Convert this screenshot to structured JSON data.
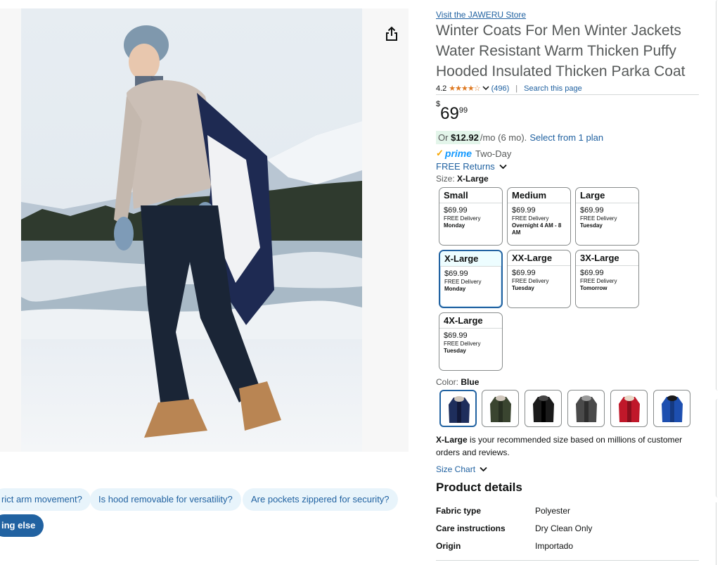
{
  "store_link": "Visit the JAWERU Store",
  "title": "Winter Coats For Men Winter Jackets Water Resistant Warm Thicken Puffy Hooded Insulated Thicken Parka Coat",
  "rating": {
    "value": "4.2",
    "stars": "★★★★☆",
    "count": "(496)",
    "search_link": "Search this page"
  },
  "price": {
    "currency": "$",
    "whole": "69",
    "cents": "99"
  },
  "installment": {
    "or": "Or",
    "amount": "$12.92",
    "period": "/mo (6 mo).",
    "plan_link": "Select from 1 plan"
  },
  "prime": {
    "check": "✓",
    "word": "prime",
    "speed": "Two-Day"
  },
  "free_returns": "FREE Returns",
  "size": {
    "label": "Size:",
    "selected": "X-Large"
  },
  "sizes": [
    {
      "name": "Small",
      "price": "$69.99",
      "delivery": "FREE Delivery",
      "day": "Monday"
    },
    {
      "name": "Medium",
      "price": "$69.99",
      "delivery": "FREE Delivery",
      "day": "Overnight 4 AM - 8 AM"
    },
    {
      "name": "Large",
      "price": "$69.99",
      "delivery": "FREE Delivery",
      "day": "Tuesday"
    },
    {
      "name": "X-Large",
      "price": "$69.99",
      "delivery": "FREE Delivery",
      "day": "Monday"
    },
    {
      "name": "XX-Large",
      "price": "$69.99",
      "delivery": "FREE Delivery",
      "day": "Tuesday"
    },
    {
      "name": "3X-Large",
      "price": "$69.99",
      "delivery": "FREE Delivery",
      "day": "Tomorrow"
    },
    {
      "name": "4X-Large",
      "price": "$69.99",
      "delivery": "FREE Delivery",
      "day": "Tuesday"
    }
  ],
  "color": {
    "label": "Color:",
    "selected": "Blue"
  },
  "swatch_colors": [
    "#1e2e5c",
    "#3a4530",
    "#1a1a1a",
    "#4a4a4a",
    "#c0182a",
    "#1d4fb0"
  ],
  "recommendation": {
    "size": "X-Large",
    "text": " is your recommended size based on millions of customer orders and reviews."
  },
  "size_chart": "Size Chart",
  "product_details": {
    "title": "Product details",
    "rows": [
      {
        "key": "Fabric type",
        "value": "Polyester"
      },
      {
        "key": "Care instructions",
        "value": "Dry Clean Only"
      },
      {
        "key": "Origin",
        "value": "Importado"
      }
    ]
  },
  "chips": [
    "rict arm movement?",
    "Is hood removable for versatility?",
    "Are pockets zippered for security?",
    "ing else"
  ]
}
